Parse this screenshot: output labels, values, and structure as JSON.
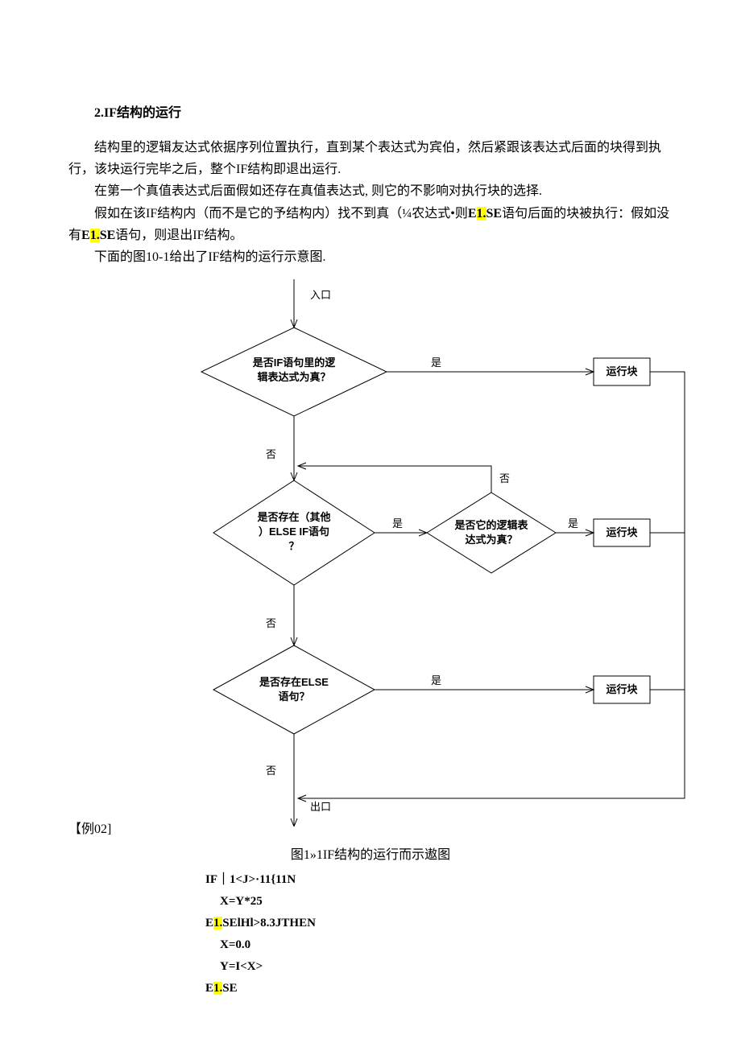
{
  "heading": "2.IF结构的运行",
  "p1": "结构里的逻辑友达式依据序列位置执行，直到某个表达式为宾伯，然后紧跟该表达式后面的块得到执行，该块运行完毕之后，整个IF结构即退出运行.",
  "p2": "在第一个真值表达式后面假如还存在真值表达式, 则它的不影响对执行块的选择.",
  "p3a": "假如在该IF结构内（而不是它的予结构内）找不到真（¼农达式•则",
  "p3b": "E1.SE",
  "p3c": "语句后面的块被执行：假如没有",
  "p3d": "E1.SE",
  "p3e": "语句，则退出IF结构。",
  "p4": "下面的图10-1给出了IF结构的运行示意图.",
  "flow": {
    "entry": "入口",
    "exit": "出口",
    "d1l1": "是否IF语句里的逻",
    "d1l2": "辑表达式为真？",
    "d2l1": "是否存在（其他",
    "d2l2": "）ELSE IF语句",
    "d2l3": "？",
    "d3l1": "是否它的逻辑表",
    "d3l2": "达式为真？",
    "d4l1": "是否存在ELSE",
    "d4l2": "语句？",
    "run": "运行块",
    "yes": "是",
    "no": "否"
  },
  "example_label": "【例02]",
  "caption": "图1»1IF结构的运行而示遨图",
  "code": {
    "l1a": "IF｜1<J>·11{11N",
    "l2": "X=Y*25",
    "l3a": "E",
    "l3b": "1.",
    "l3c": "SElHl>8.3JTHEN",
    "l4": "X=0.0",
    "l5": "Y=I<X>",
    "l6a": "E",
    "l6b": "1.",
    "l6c": "SE"
  }
}
